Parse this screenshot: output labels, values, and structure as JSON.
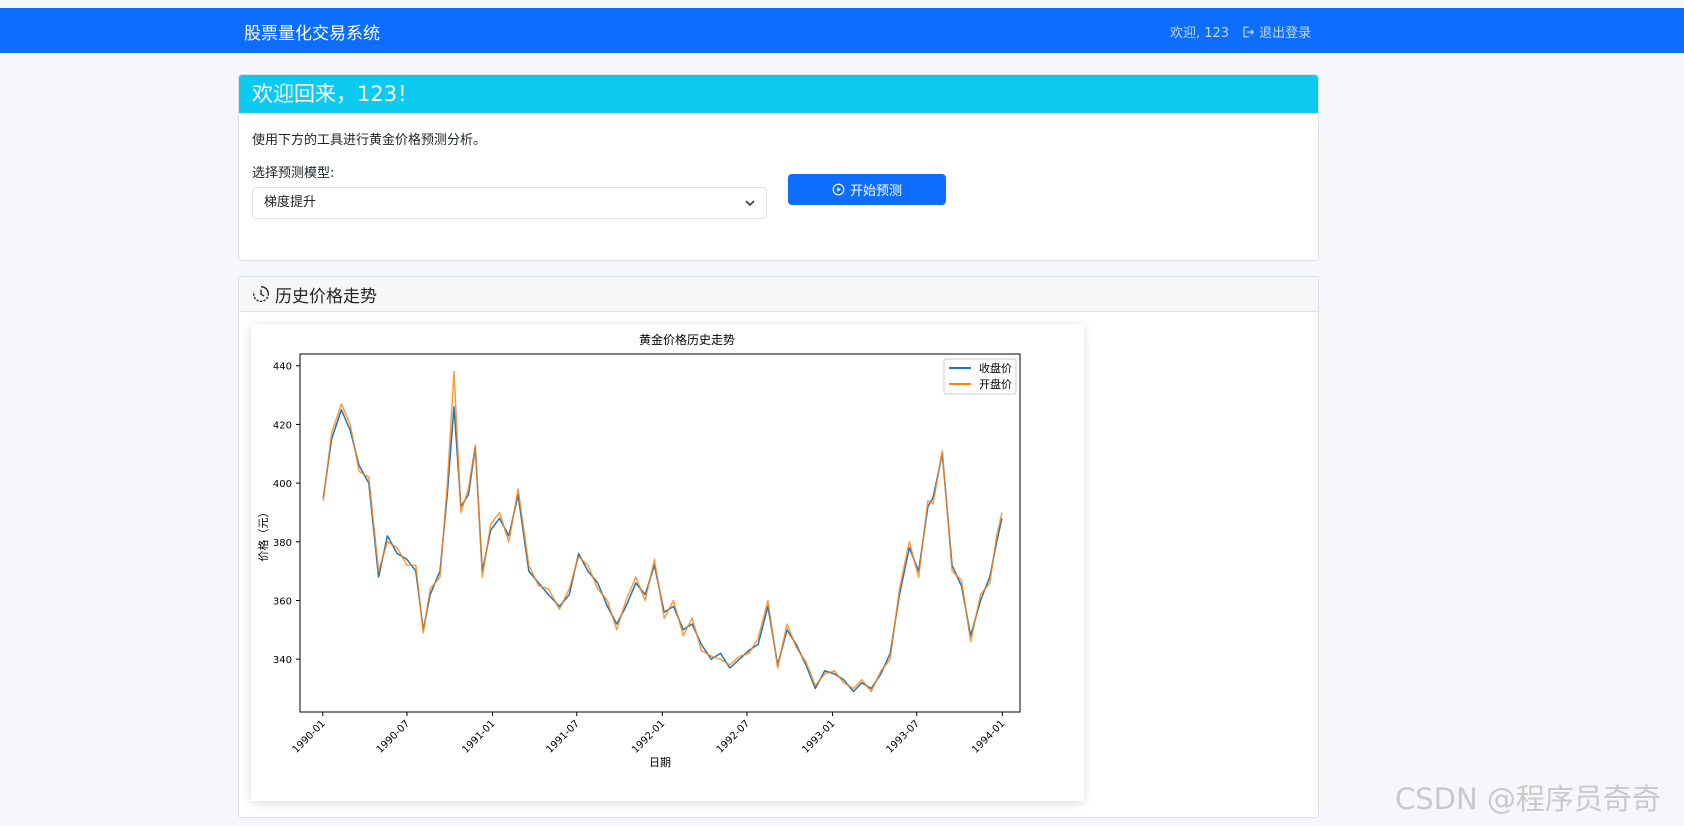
{
  "navbar": {
    "brand": "股票量化交易系统",
    "welcome": "欢迎, 123",
    "logout_label": "退出登录"
  },
  "welcome_card": {
    "heading": "欢迎回来，123！",
    "intro": "使用下方的工具进行黄金价格预测分析。",
    "model_label": "选择预测模型:",
    "model_selected": "梯度提升",
    "predict_label": "开始预测"
  },
  "history_card": {
    "heading": "历史价格走势"
  },
  "watermark": "CSDN @程序员奇奇",
  "colors": {
    "primary": "#0d6efd",
    "info": "#0dcaf0",
    "close_series": "#1f77b4",
    "open_series": "#ff7f0e"
  },
  "chart_data": {
    "type": "line",
    "title": "黄金价格历史走势",
    "xlabel": "日期",
    "ylabel": "价格（元）",
    "ylim": [
      322,
      444
    ],
    "xlim": [
      "1989-11-13",
      "1994-02-08"
    ],
    "xticks": [
      "1990-01",
      "1990-07",
      "1991-01",
      "1991-07",
      "1992-01",
      "1992-07",
      "1993-01",
      "1993-07",
      "1994-01"
    ],
    "yticks": [
      340,
      360,
      380,
      400,
      420,
      440
    ],
    "legend_position": "top-right",
    "series": [
      {
        "name": "收盘价",
        "x": [
          "1990-01-02",
          "1990-01-20",
          "1990-02-10",
          "1990-03-01",
          "1990-03-20",
          "1990-04-10",
          "1990-05-01",
          "1990-05-20",
          "1990-06-10",
          "1990-07-01",
          "1990-07-20",
          "1990-08-05",
          "1990-08-20",
          "1990-09-10",
          "1990-09-25",
          "1990-10-10",
          "1990-10-25",
          "1990-11-10",
          "1990-11-25",
          "1990-12-10",
          "1990-12-28",
          "1991-01-16",
          "1991-02-05",
          "1991-02-25",
          "1991-03-20",
          "1991-04-10",
          "1991-05-01",
          "1991-05-25",
          "1991-06-15",
          "1991-07-05",
          "1991-07-25",
          "1991-08-15",
          "1991-09-05",
          "1991-09-25",
          "1991-10-15",
          "1991-11-05",
          "1991-11-25",
          "1991-12-15",
          "1992-01-05",
          "1992-01-25",
          "1992-02-15",
          "1992-03-05",
          "1992-03-25",
          "1992-04-15",
          "1992-05-05",
          "1992-05-25",
          "1992-06-15",
          "1992-07-05",
          "1992-07-25",
          "1992-08-15",
          "1992-09-05",
          "1992-09-25",
          "1992-10-15",
          "1992-11-05",
          "1992-11-25",
          "1992-12-15",
          "1993-01-05",
          "1993-01-25",
          "1993-02-15",
          "1993-03-05",
          "1993-03-25",
          "1993-04-15",
          "1993-05-05",
          "1993-05-25",
          "1993-06-15",
          "1993-07-05",
          "1993-07-25",
          "1993-08-05",
          "1993-08-25",
          "1993-09-15",
          "1993-10-05",
          "1993-10-25",
          "1993-11-15",
          "1993-12-05",
          "1993-12-20",
          "1993-12-31"
        ],
        "values": [
          395,
          415,
          425,
          418,
          406,
          400,
          368,
          382,
          376,
          374,
          370,
          350,
          362,
          370,
          395,
          426,
          392,
          396,
          412,
          370,
          384,
          388,
          382,
          396,
          370,
          366,
          362,
          358,
          362,
          376,
          370,
          366,
          358,
          352,
          358,
          366,
          362,
          372,
          356,
          358,
          350,
          352,
          345,
          340,
          342,
          337,
          340,
          343,
          345,
          358,
          338,
          350,
          345,
          338,
          330,
          336,
          335,
          333,
          329,
          332,
          330,
          335,
          342,
          362,
          378,
          370,
          392,
          395,
          410,
          372,
          365,
          348,
          360,
          368,
          380,
          388
        ]
      },
      {
        "name": "开盘价",
        "x": [
          "1990-01-02",
          "1990-01-20",
          "1990-02-10",
          "1990-03-01",
          "1990-03-20",
          "1990-04-10",
          "1990-05-01",
          "1990-05-20",
          "1990-06-10",
          "1990-07-01",
          "1990-07-20",
          "1990-08-05",
          "1990-08-20",
          "1990-09-10",
          "1990-09-25",
          "1990-10-10",
          "1990-10-25",
          "1990-11-10",
          "1990-11-25",
          "1990-12-10",
          "1990-12-28",
          "1991-01-16",
          "1991-02-05",
          "1991-02-25",
          "1991-03-20",
          "1991-04-10",
          "1991-05-01",
          "1991-05-25",
          "1991-06-15",
          "1991-07-05",
          "1991-07-25",
          "1991-08-15",
          "1991-09-05",
          "1991-09-25",
          "1991-10-15",
          "1991-11-05",
          "1991-11-25",
          "1991-12-15",
          "1992-01-05",
          "1992-01-25",
          "1992-02-15",
          "1992-03-05",
          "1992-03-25",
          "1992-04-15",
          "1992-05-05",
          "1992-05-25",
          "1992-06-15",
          "1992-07-05",
          "1992-07-25",
          "1992-08-15",
          "1992-09-05",
          "1992-09-25",
          "1992-10-15",
          "1992-11-05",
          "1992-11-25",
          "1992-12-15",
          "1993-01-05",
          "1993-01-25",
          "1993-02-15",
          "1993-03-05",
          "1993-03-25",
          "1993-04-15",
          "1993-05-05",
          "1993-05-25",
          "1993-06-15",
          "1993-07-05",
          "1993-07-25",
          "1993-08-05",
          "1993-08-25",
          "1993-09-15",
          "1993-10-05",
          "1993-10-25",
          "1993-11-15",
          "1993-12-05",
          "1993-12-20",
          "1993-12-31"
        ],
        "values": [
          394,
          417,
          427,
          420,
          404,
          402,
          370,
          380,
          378,
          372,
          372,
          349,
          364,
          368,
          398,
          438,
          390,
          398,
          413,
          368,
          386,
          390,
          380,
          398,
          372,
          365,
          364,
          357,
          364,
          375,
          372,
          364,
          360,
          350,
          360,
          368,
          360,
          374,
          354,
          360,
          348,
          354,
          343,
          341,
          340,
          338,
          341,
          342,
          347,
          360,
          337,
          352,
          344,
          339,
          331,
          335,
          336,
          332,
          330,
          333,
          329,
          336,
          340,
          364,
          380,
          368,
          394,
          393,
          411,
          370,
          367,
          346,
          362,
          366,
          382,
          390
        ]
      }
    ]
  }
}
